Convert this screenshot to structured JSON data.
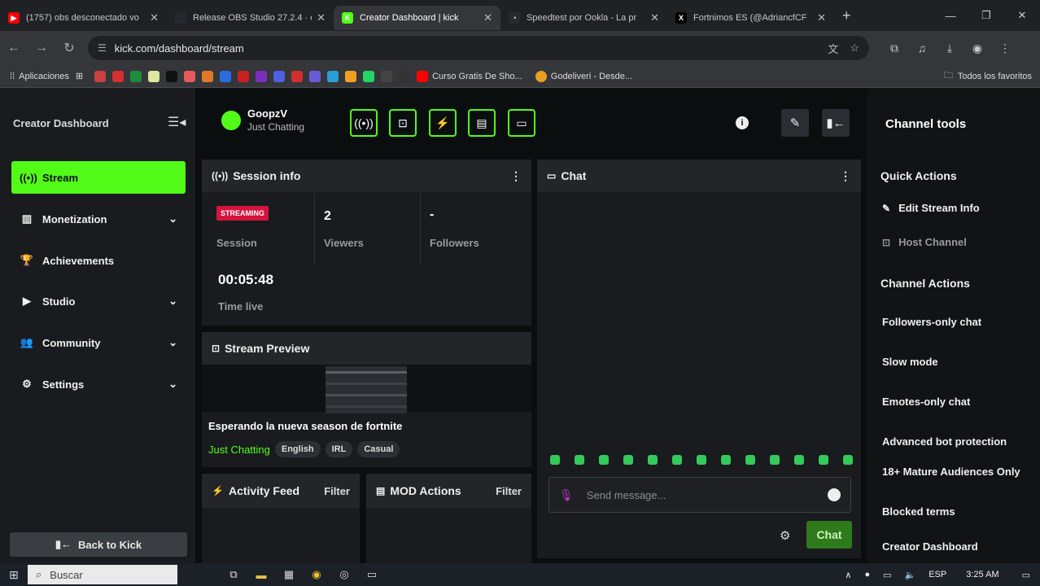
{
  "browser": {
    "tabs": [
      {
        "title": "(1757) obs desconectado vo",
        "fav_color": "#ff0000",
        "fav_text": "▶"
      },
      {
        "title": "Release OBS Studio 27.2.4 · c",
        "fav_color": "#24292f",
        "fav_text": ""
      },
      {
        "title": "Creator Dashboard | kick",
        "fav_color": "#53fc18",
        "fav_text": "K",
        "active": true
      },
      {
        "title": "Speedtest por Ookla - La pr",
        "fav_color": "#2a2a2a",
        "fav_text": "◔"
      },
      {
        "title": "Fortnimos ES (@AdriancfCF",
        "fav_color": "#000000",
        "fav_text": "X"
      }
    ],
    "url": "kick.com/dashboard/stream",
    "bookmarks_apps_label": "Aplicaciones",
    "bookmarks": [
      {
        "label": "Curso Gratis De Sho...",
        "color": "#ff0000"
      },
      {
        "label": "Godeliveri - Desde...",
        "color": "#e8a020"
      }
    ],
    "bookmark_icons": [
      "#c94040",
      "#d72f2f",
      "#1e8c3a",
      "#dfe7a0",
      "#111111",
      "#e65a5a",
      "#e07a2a",
      "#2d6be0",
      "#cc2020",
      "#7b2fbe",
      "#5060e0",
      "#d03030",
      "#6a5bd6",
      "#2a9fd6",
      "#f0a020",
      "#25d366",
      "#444444",
      "#333333"
    ],
    "all_bookmarks_label": "Todos los favoritos"
  },
  "sidebar": {
    "title": "Creator Dashboard",
    "items": [
      {
        "label": "Stream",
        "icon": "broadcast-icon",
        "glyph": "((•))",
        "active": true,
        "chevron": false
      },
      {
        "label": "Monetization",
        "icon": "chart-icon",
        "glyph": "▥",
        "chevron": true
      },
      {
        "label": "Achievements",
        "icon": "trophy-icon",
        "glyph": "🏆",
        "chevron": false
      },
      {
        "label": "Studio",
        "icon": "studio-icon",
        "glyph": "▶",
        "chevron": true
      },
      {
        "label": "Community",
        "icon": "community-icon",
        "glyph": "👥",
        "chevron": true
      },
      {
        "label": "Settings",
        "icon": "gear-icon",
        "glyph": "⚙",
        "chevron": true
      }
    ],
    "back_label": "Back to Kick"
  },
  "header": {
    "username": "GoopzV",
    "category": "Just Chatting"
  },
  "session": {
    "title": "Session info",
    "badge": "STREAMING",
    "session_label": "Session",
    "viewers_value": "2",
    "viewers_label": "Viewers",
    "followers_value": "-",
    "followers_label": "Followers",
    "time_value": "00:05:48",
    "time_label": "Time live"
  },
  "preview": {
    "title": "Stream Preview",
    "stream_title": "Esperando la nueva season de fortnite",
    "category": "Just Chatting",
    "tags": [
      "English",
      "IRL",
      "Casual"
    ]
  },
  "activity": {
    "title": "Activity Feed",
    "filter": "Filter"
  },
  "mod": {
    "title": "MOD Actions",
    "filter": "Filter"
  },
  "chat": {
    "title": "Chat",
    "placeholder": "Send message...",
    "send_label": "Chat",
    "emote_count": 13
  },
  "tools": {
    "title": "Channel tools",
    "quick_title": "Quick Actions",
    "edit_label": "Edit Stream Info",
    "host_label": "Host Channel",
    "channel_title": "Channel Actions",
    "actions": [
      "Followers-only chat",
      "Slow mode",
      "Emotes-only chat",
      "Advanced bot protection",
      "18+ Mature Audiences Only",
      "Blocked terms",
      "Creator Dashboard"
    ]
  },
  "taskbar": {
    "search": "Buscar",
    "lang": "ESP",
    "time": "3:25 AM"
  }
}
